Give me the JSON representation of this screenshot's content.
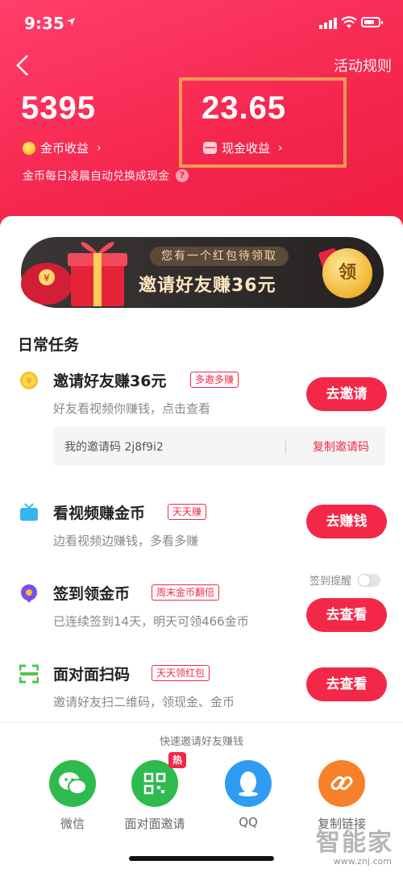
{
  "status": {
    "time": "9:35"
  },
  "header": {
    "rules_label": "活动规则",
    "coin_amount": "5395",
    "cash_amount": "23.65",
    "coin_label": "金币收益",
    "cash_label": "现金收益",
    "exchange_note": "金币每日凌晨自动兑换成现金",
    "help_mark": "?"
  },
  "banner": {
    "sub": "您有一个红包待领取",
    "title": "邀请好友赚36元",
    "claim": "领"
  },
  "section_title": "日常任务",
  "tasks": [
    {
      "title": "邀请好友赚36元",
      "tag": "多邀多赚",
      "desc": "好友看视频你赚钱，点击查看",
      "button": "去邀请",
      "icon": "coin-icon"
    },
    {
      "title": "看视频赚金币",
      "tag": "天天赚",
      "desc": "边看视频边赚钱，多看多赚",
      "button": "去赚钱",
      "icon": "tv-icon"
    },
    {
      "title": "签到领金币",
      "tag": "周末金币翻倍",
      "desc": "已连续签到14天，明天可领466金币",
      "button": "去查看",
      "icon": "location-pin-icon"
    },
    {
      "title": "面对面扫码",
      "tag": "天天领红包",
      "desc": "邀请好友扫二维码，领现金、金币",
      "button": "去查看",
      "icon": "scan-icon"
    }
  ],
  "invite_code": {
    "text": "我的邀请码 2j8f9i2",
    "copy": "复制邀请码"
  },
  "remind_label": "签到提醒",
  "share": {
    "title": "快速邀请好友赚钱",
    "hot": "热",
    "items": [
      {
        "label": "微信",
        "color": "#2dbb4e",
        "icon": "wechat-icon"
      },
      {
        "label": "面对面邀请",
        "color": "#2dbb4e",
        "icon": "qr-code-icon"
      },
      {
        "label": "QQ",
        "color": "#2f9cf4",
        "icon": "qq-icon"
      },
      {
        "label": "复制链接",
        "color": "#f7812a",
        "icon": "link-icon"
      }
    ]
  },
  "watermark": {
    "text": "智能家",
    "url": "www.znj.com"
  },
  "colors": {
    "primary": "#f5274f",
    "button": "#f32848",
    "highlight": "#f49a50"
  }
}
